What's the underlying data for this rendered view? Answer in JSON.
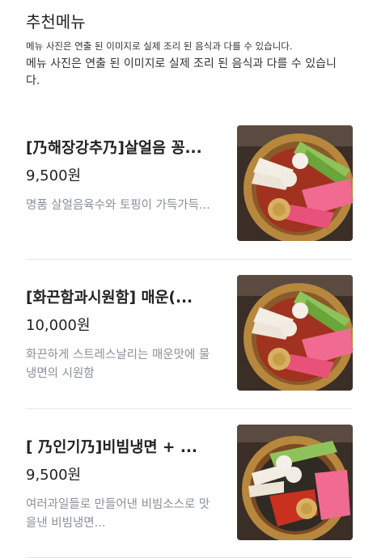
{
  "header": {
    "title": "추천메뉴",
    "notice_small": "메뉴 사진은 연출 된 이미지로 실제 조리 된 음식과 다를 수 있습니다.",
    "notice_large": "메뉴 사진은 연출 된 이미지로 실제 조리 된 음식과 다를 수 있습니다."
  },
  "menu_items": [
    {
      "name": "[乃해장강추乃]살얼음 꽁...",
      "price": "9,500원",
      "description": "명품 살얼음육수와 토핑이 가득가득..."
    },
    {
      "name": "[화끈함과시원함] 매운(...",
      "price": "10,000원",
      "description": "화끈하게 스트레스날리는 매운맛에 물냉면의 시원함"
    },
    {
      "name": "[ 乃인기乃]비빔냉면 + ...",
      "price": "9,500원",
      "description": "여러과일들로 만들어낸 비빔소스로 맛을낸 비빔냉면..."
    }
  ]
}
